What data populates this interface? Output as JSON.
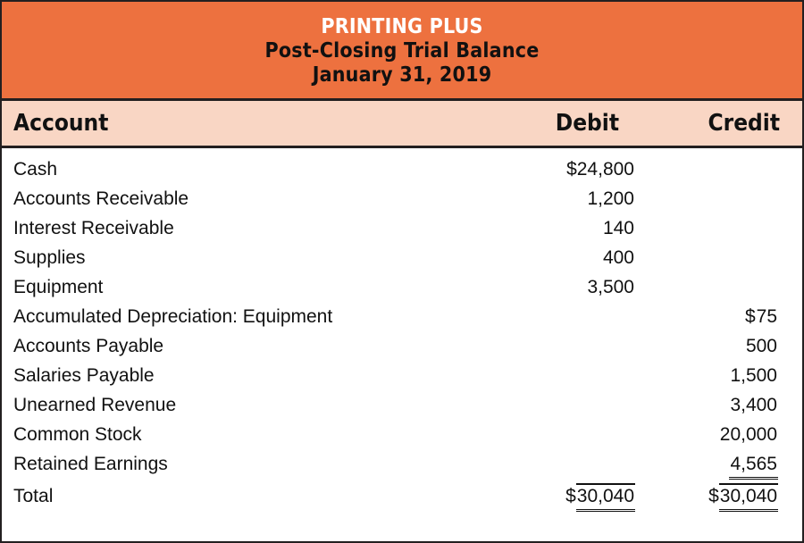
{
  "statement": {
    "company": "PRINTING PLUS",
    "title": "Post-Closing Trial Balance",
    "period": "January 31, 2019"
  },
  "columns": {
    "account": "Account",
    "debit": "Debit",
    "credit": "Credit"
  },
  "colors": {
    "title_band": "#ED713F",
    "column_header_band": "#F9D6C4",
    "border": "#231f20",
    "company_text": "#FFFFFF",
    "body_text": "#111111"
  },
  "rows": [
    {
      "account": "Cash",
      "debit": "$24,800",
      "credit": ""
    },
    {
      "account": "Accounts Receivable",
      "debit": "1,200",
      "credit": ""
    },
    {
      "account": "Interest Receivable",
      "debit": "140",
      "credit": ""
    },
    {
      "account": "Supplies",
      "debit": "400",
      "credit": ""
    },
    {
      "account": "Equipment",
      "debit": "3,500",
      "credit": ""
    },
    {
      "account": "Accumulated Depreciation: Equipment",
      "debit": "",
      "credit": "75",
      "credit_currency": "$"
    },
    {
      "account": "Accounts Payable",
      "debit": "",
      "credit": "500"
    },
    {
      "account": "Salaries Payable",
      "debit": "",
      "credit": "1,500"
    },
    {
      "account": "Unearned Revenue",
      "debit": "",
      "credit": "3,400"
    },
    {
      "account": "Common Stock",
      "debit": "",
      "credit": "20,000"
    },
    {
      "account": "Retained Earnings",
      "debit": "",
      "credit": "4,565"
    }
  ],
  "total": {
    "account": "Total",
    "debit_currency": "$",
    "debit": "30,040",
    "credit_currency": "$",
    "credit": "30,040"
  },
  "chart_data": {
    "type": "table",
    "title": "Printing Plus — Post-Closing Trial Balance, January 31, 2019",
    "columns": [
      "Account",
      "Debit",
      "Credit"
    ],
    "rows": [
      [
        "Cash",
        24800,
        null
      ],
      [
        "Accounts Receivable",
        1200,
        null
      ],
      [
        "Interest Receivable",
        140,
        null
      ],
      [
        "Supplies",
        400,
        null
      ],
      [
        "Equipment",
        3500,
        null
      ],
      [
        "Accumulated Depreciation: Equipment",
        null,
        75
      ],
      [
        "Accounts Payable",
        null,
        500
      ],
      [
        "Salaries Payable",
        null,
        1500
      ],
      [
        "Unearned Revenue",
        null,
        3400
      ],
      [
        "Common Stock",
        null,
        20000
      ],
      [
        "Retained Earnings",
        null,
        4565
      ],
      [
        "Total",
        30040,
        30040
      ]
    ],
    "debit_total": 30040,
    "credit_total": 30040
  }
}
